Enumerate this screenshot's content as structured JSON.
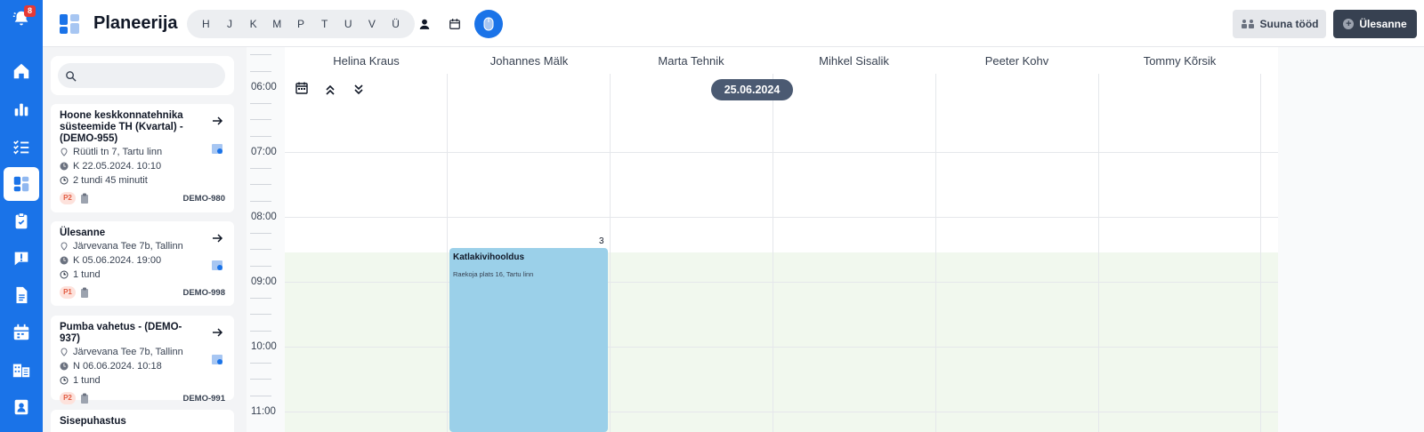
{
  "sidebar": {
    "notification_count": "8",
    "items": [
      "bell-icon",
      "home-icon",
      "chart-icon",
      "checklist-icon",
      "planner-icon",
      "clipboard-icon",
      "alert-icon",
      "document-icon",
      "calendar-icon",
      "building-icon",
      "contact-icon"
    ]
  },
  "header": {
    "title": "Planeerija",
    "days": [
      "H",
      "J",
      "K",
      "M",
      "P",
      "T",
      "U",
      "V",
      "Ü"
    ],
    "suuna_label": "Suuna tööd",
    "add_label": "Ülesanne"
  },
  "search": {
    "placeholder": ""
  },
  "tasks": [
    {
      "title": "Hoone keskkonnatehnika süsteemide TH (Kvartal) - (DEMO-955)",
      "address": "Rüütli tn 7, Tartu linn",
      "deadline": "K 22.05.2024. 10:10",
      "duration": "2 tundi 45 minutit",
      "priority": "P2",
      "id": "DEMO-980"
    },
    {
      "title": "Ülesanne",
      "address": "Järvevana Tee 7b, Tallinn",
      "deadline": "K 05.06.2024. 19:00",
      "duration": "1 tund",
      "priority": "P1",
      "id": "DEMO-998"
    },
    {
      "title": "Pumba vahetus - (DEMO-937)",
      "address": "Järvevana Tee 7b, Tallinn",
      "deadline": "N 06.06.2024. 10:18",
      "duration": "1 tund",
      "priority": "P2",
      "id": "DEMO-991"
    },
    {
      "title": "Sisepuhastus"
    }
  ],
  "calendar": {
    "columns": [
      "Helina Kraus",
      "Johannes Mälk",
      "Marta Tehnik",
      "Mihkel Sisalik",
      "Peeter Kohv",
      "Tommy Kõrsik"
    ],
    "times": [
      "06:00",
      "07:00",
      "08:00",
      "09:00",
      "10:00",
      "11:00"
    ],
    "date": "25.06.2024",
    "event": {
      "title": "Katlakivihooldus",
      "address": "Raekoja plats 16, Tartu linn",
      "count": "3"
    }
  },
  "colors": {
    "primary": "#1a73e8",
    "event": "#9bd0e9",
    "date_pill": "#4b5a72",
    "priority_bg": "#fde2dc",
    "priority_text": "#e25b41"
  }
}
